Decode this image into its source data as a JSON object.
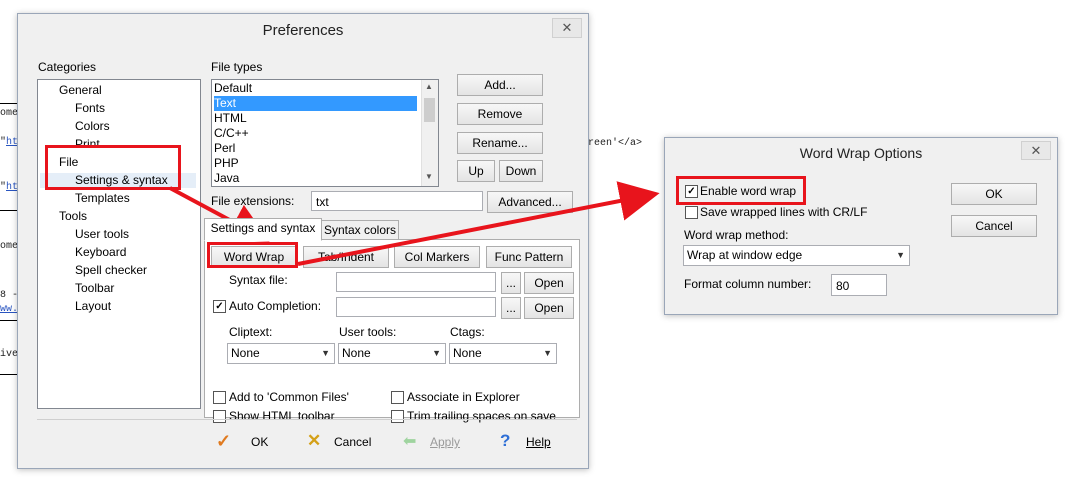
{
  "background": {
    "frag1": "ome",
    "frag2_quote": "\"",
    "frag2_link": "ht",
    "frag3_quote": "\"",
    "frag3_link": "ht",
    "frag4": "ome",
    "frag5": "8 -",
    "frag6": "ww.",
    "frag7": "ive",
    "right_fragment": "reen'</a>"
  },
  "preferences": {
    "title": "Preferences",
    "close": "✕",
    "categories_label": "Categories",
    "categories": {
      "general": "General",
      "fonts": "Fonts",
      "colors": "Colors",
      "print": "Print",
      "file": "File",
      "settings_syntax": "Settings & syntax",
      "templates": "Templates",
      "tools": "Tools",
      "user_tools": "User tools",
      "keyboard": "Keyboard",
      "spell_checker": "Spell checker",
      "toolbar": "Toolbar",
      "layout": "Layout"
    },
    "file_types_label": "File types",
    "file_types": [
      "Default",
      "Text",
      "HTML",
      "C/C++",
      "Perl",
      "PHP",
      "Java"
    ],
    "selected_file_type": "Text",
    "buttons": {
      "add": "Add...",
      "remove": "Remove",
      "rename": "Rename...",
      "up": "Up",
      "down": "Down",
      "advanced": "Advanced..."
    },
    "file_extensions_label": "File extensions:",
    "file_extensions_value": "txt",
    "tabs": {
      "settings_syntax": "Settings and syntax",
      "syntax_colors": "Syntax colors"
    },
    "inner_buttons": {
      "word_wrap": "Word Wrap",
      "tab_indent": "Tab/Indent",
      "col_markers": "Col Markers",
      "func_pattern": "Func Pattern"
    },
    "syntax_file_label": "Syntax file:",
    "auto_completion_label": "Auto Completion:",
    "auto_completion_checked": true,
    "ellipsis": "...",
    "open": "Open",
    "cliptext_label": "Cliptext:",
    "cliptext_value": "None",
    "user_tools_label": "User tools:",
    "user_tools_value": "None",
    "ctags_label": "Ctags:",
    "ctags_value": "None",
    "checkboxes": {
      "add_common": "Add to 'Common Files'",
      "associate_explorer": "Associate in Explorer",
      "show_html_toolbar": "Show HTML toolbar",
      "trim_trailing": "Trim trailing spaces on save"
    },
    "footer": {
      "ok": "OK",
      "cancel": "Cancel",
      "apply": "Apply",
      "help": "Help"
    }
  },
  "word_wrap_options": {
    "title": "Word Wrap Options",
    "close": "✕",
    "enable_word_wrap": "Enable word wrap",
    "enable_word_wrap_checked": true,
    "save_crlf": "Save wrapped lines with CR/LF",
    "save_crlf_checked": false,
    "method_label": "Word wrap method:",
    "method_value": "Wrap at window edge",
    "format_column_label": "Format column number:",
    "format_column_value": "80",
    "ok": "OK",
    "cancel": "Cancel"
  },
  "colors": {
    "annotation_red": "#e8141c",
    "selection_blue": "#3399ff"
  }
}
